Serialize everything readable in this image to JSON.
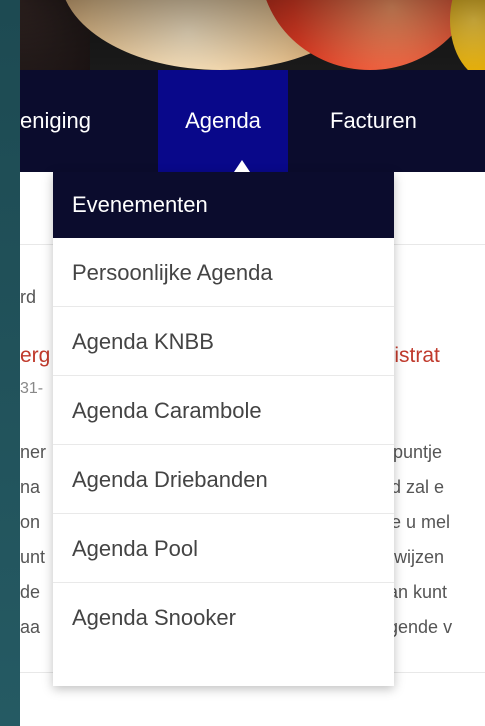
{
  "nav": {
    "items": [
      "eniging",
      "Agenda",
      "Facturen"
    ],
    "active_index": 1
  },
  "dropdown": {
    "items": [
      "Evenementen",
      "Persoonlijke Agenda",
      "Agenda KNBB",
      "Agenda Carambole",
      "Agenda Driebanden",
      "Agenda Pool",
      "Agenda Snooker"
    ]
  },
  "background": {
    "left_fragments": [
      "rd",
      "erg",
      "31-",
      "ner",
      "na",
      "on",
      "unt",
      "de",
      "aa"
    ],
    "right_fragments": [
      "inistrat",
      "e puntje",
      "tijd zal e",
      "we u mel",
      "erwijzen",
      "dan kunt",
      "ngende v"
    ]
  },
  "colors": {
    "nav_bg": "#0b0c2d",
    "nav_active": "#09088a",
    "link_red": "#c0392b",
    "frame": "#1f4f57"
  }
}
